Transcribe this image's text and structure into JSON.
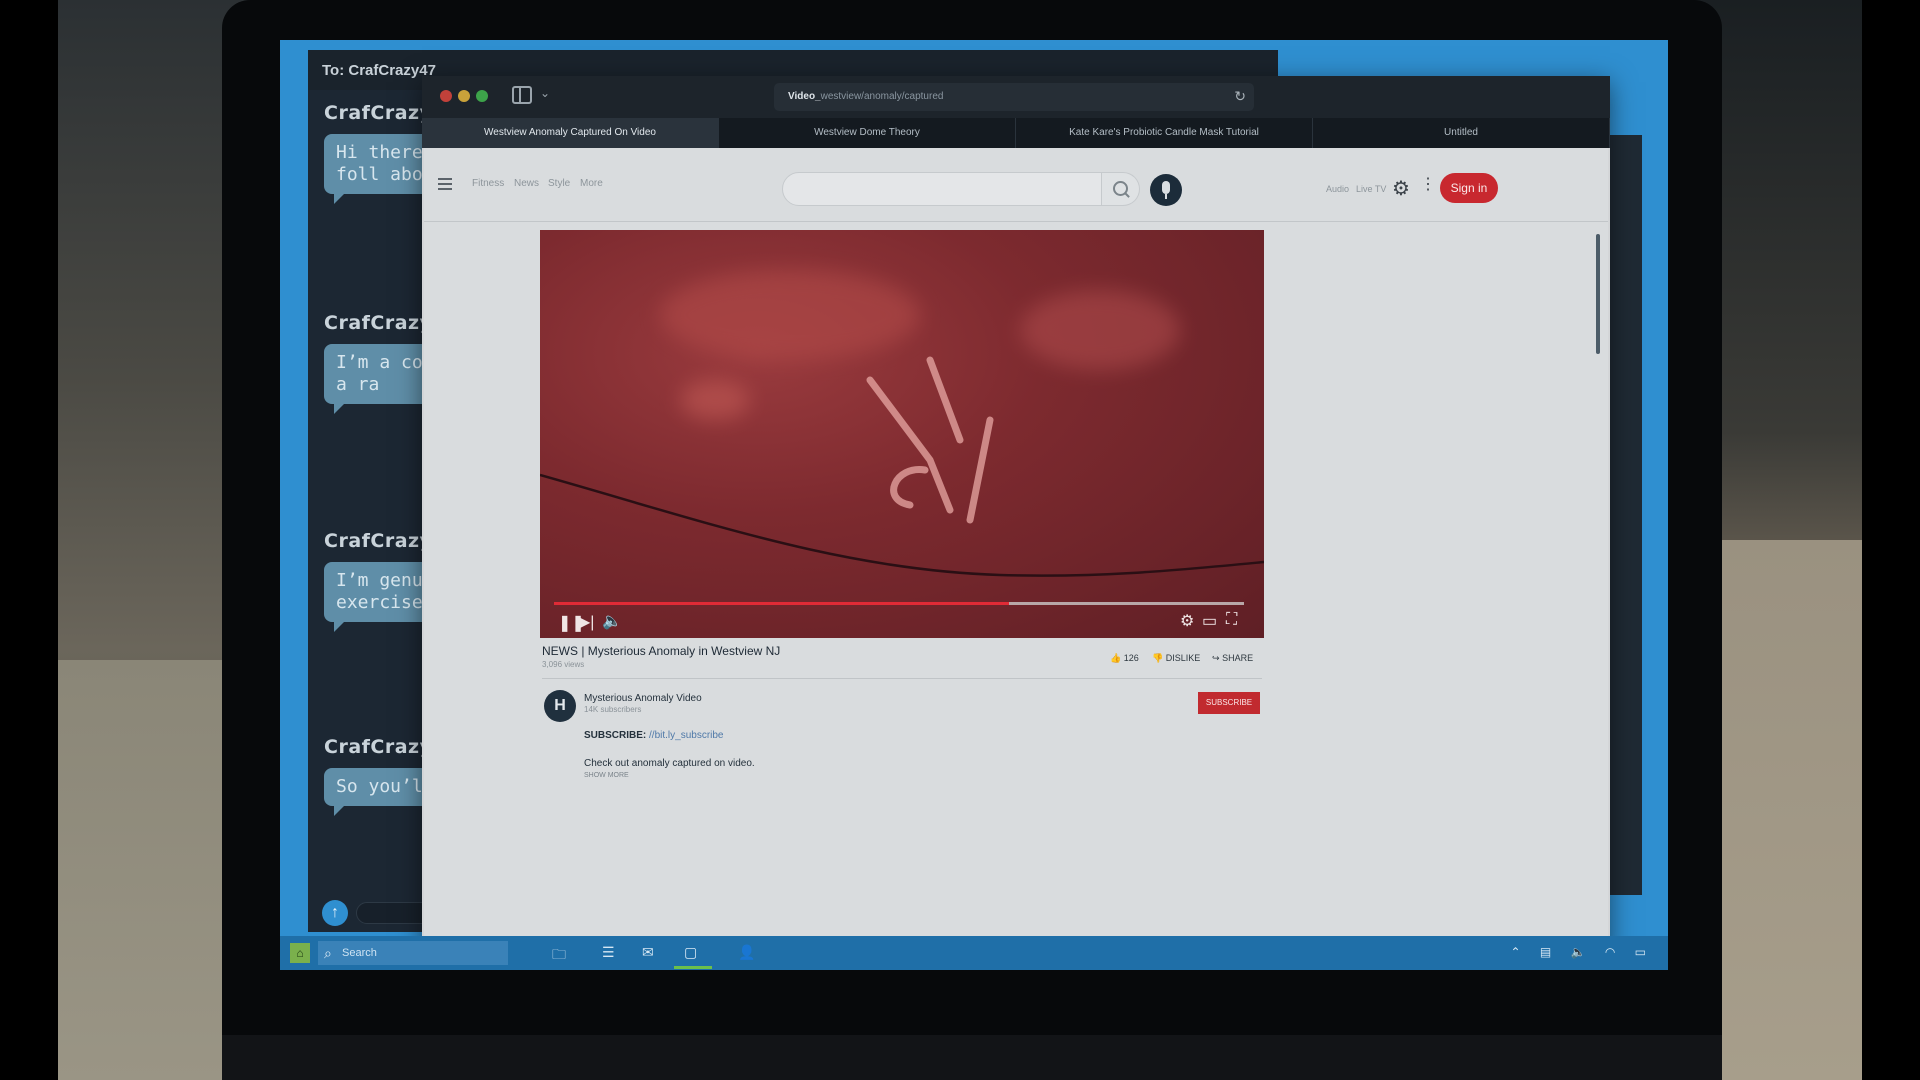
{
  "chat": {
    "title": "To: CrafCrazy47",
    "messages": [
      {
        "name": "CrafCrazy",
        "text": "Hi there! it’s proba been foll about wh"
      },
      {
        "name": "CrafCrazy",
        "text": "I’m a con the night just a ra"
      },
      {
        "name": "CrafCrazy",
        "text": "I’m genu vitamix, exercise"
      },
      {
        "name": "CrafCrazy",
        "text": "So you’ll"
      }
    ]
  },
  "browser": {
    "url_bold": "Video_",
    "url_rest": "westview/anomaly/captured",
    "tabs": [
      {
        "label": "Westview Anomaly Captured On Video",
        "active": true
      },
      {
        "label": "Westview Dome Theory",
        "active": false
      },
      {
        "label": "Kate Kare's Probiotic Candle Mask Tutorial",
        "active": false
      },
      {
        "label": "Untitled",
        "active": false
      }
    ]
  },
  "site": {
    "nav": [
      "Fitness",
      "News",
      "Style",
      "More"
    ],
    "header_links": [
      "Audio",
      "Live TV"
    ],
    "sign_in": "Sign in"
  },
  "video": {
    "title": "NEWS | Mysterious Anomaly in Westview NJ",
    "views": "3,096 views",
    "progress": 0.66,
    "likes": "126",
    "dislike": "DISLIKE",
    "share": "SHARE",
    "channel": {
      "avatar_letter": "H",
      "name": "Mysterious Anomaly Video",
      "subscribers": "14K subscribers",
      "subscribe": "SUBSCRIBE"
    },
    "description": {
      "subscribe_label": "SUBSCRIBE:",
      "subscribe_link": "//bit.ly_subscribe",
      "text": "Check out anomaly captured on video.",
      "show_more": "SHOW MORE"
    }
  },
  "taskbar": {
    "search_placeholder": "Search"
  },
  "colors": {
    "accent_red": "#c8282f",
    "desktop_blue": "#2f8fd0",
    "chat_bubble": "#5f8ea8"
  }
}
